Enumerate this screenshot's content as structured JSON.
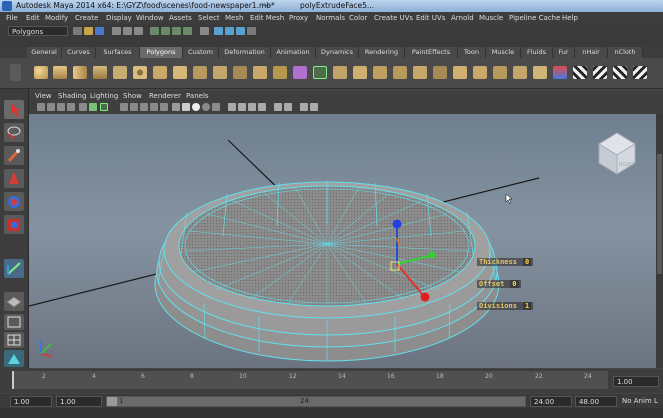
{
  "window": {
    "title": "Autodesk Maya 2014 x64: E:\\GYZ\\food\\scenes\\food-newspaper1.mb*",
    "separator": "---",
    "node": "polyExtrudeFace5..."
  },
  "menus": [
    "File",
    "Edit",
    "Modify",
    "Create",
    "Display",
    "Window",
    "Assets",
    "Select",
    "Mesh",
    "Edit Mesh",
    "Proxy",
    "Normals",
    "Color",
    "Create UVs",
    "Edit UVs",
    "Arnold",
    "Muscle",
    "Pipeline Cache",
    "Help"
  ],
  "mode_selector": {
    "value": "Polygons"
  },
  "shelf_tabs": [
    "General",
    "Curves",
    "Surfaces",
    "Polygons",
    "Custom",
    "Deformation",
    "Animation",
    "Dynamics",
    "Rendering",
    "PaintEffects",
    "Toon",
    "Muscle",
    "Fluids",
    "Fur",
    "nHair",
    "nCloth"
  ],
  "active_shelf_tab": "Polygons",
  "panel_menu": [
    "View",
    "Shading",
    "Lighting",
    "Show",
    "Renderer",
    "Panels"
  ],
  "viewcube": {
    "face": "RIGHT"
  },
  "hud": {
    "thickness_label": "Thickness",
    "thickness_value": "0",
    "offset_label": "Offset",
    "offset_value": "0",
    "divisions_label": "Divisions",
    "divisions_value": "1"
  },
  "timeline": {
    "ticks": [
      "2",
      "4",
      "6",
      "8",
      "10",
      "12",
      "14",
      "16",
      "18",
      "20",
      "22",
      "24"
    ],
    "current_frame": "1.00"
  },
  "range": {
    "start": "1.00",
    "playback_start": "1.00",
    "slider_start": "1",
    "slider_end": "24",
    "playback_end": "24.00",
    "end": "48.00",
    "anim_layer": "No Anim L"
  },
  "colors": {
    "wire": "#61e1ee",
    "viewport_top": "#6f7f8f",
    "hud_text": "#e8c46a",
    "active_tab": "#6a6a6a"
  },
  "icons": {
    "left_toolbar": [
      "select-arrow-icon",
      "lasso-icon",
      "paint-select-icon",
      "move-icon",
      "rotate-icon",
      "scale-icon",
      "manipulator-icon",
      "last-tool-icon",
      "layout-single-icon",
      "layout-four-icon",
      "outliner-icon"
    ]
  }
}
